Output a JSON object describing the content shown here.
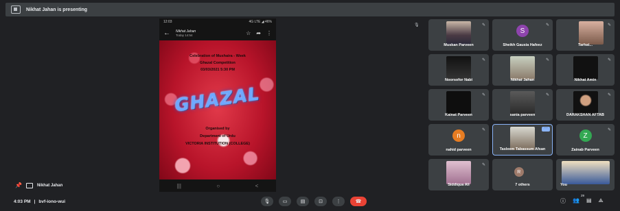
{
  "banner": {
    "text": "Nikhat Jahan is presenting"
  },
  "phone": {
    "status_time": "12:03",
    "status_right": "4G LTE ◢ 46%",
    "sender": "Nikhat Jahan",
    "date": "Today 14:54",
    "back_icon": "arrow-left-icon",
    "star_icon": "star-icon",
    "share_icon": "share-icon",
    "menu_icon": "more-vert-icon"
  },
  "poster": {
    "line1": "Celebration of Mushaira - Week",
    "line2": "Ghazal Competition",
    "line3": "03/03/2021   5:30 PM",
    "title": "GHAZAL",
    "line4": "Organised by",
    "line5": "Department of Urdu",
    "line6": "VICTORIA INSTITUTION (COLLEGE)"
  },
  "nav": {
    "recent": "|||",
    "home": "○",
    "back": "<"
  },
  "presenter": {
    "name": "Nikhat Jahan"
  },
  "tiles": [
    {
      "name": "Muskan Parveen"
    },
    {
      "name": "Sheikh Gausia Hafeez",
      "initial": "S"
    },
    {
      "name": "Tarhat..."
    },
    {
      "name": "Noorsofor Nabi"
    },
    {
      "name": "Nikhat Jahan"
    },
    {
      "name": "Nikhat Amin"
    },
    {
      "name": "Kainat Parveen"
    },
    {
      "name": "sania parveen"
    },
    {
      "name": "DARAKSHAN AFTAB"
    },
    {
      "name": "nahid parveen",
      "initial": "n"
    },
    {
      "name": "Tasleem Tabassum Afsan"
    },
    {
      "name": "Zainab Parveen",
      "initial": "Z"
    },
    {
      "name": "Siddiqua Ali"
    },
    {
      "name": "7 others"
    },
    {
      "name": "You"
    }
  ],
  "bottom": {
    "time": "4:03 PM",
    "separator": "|",
    "code": "bvf-iono-wui",
    "participants_count": "29"
  },
  "colors": {
    "background": "#202124",
    "tile": "#3c4043",
    "end_call": "#ea4335",
    "active_border": "#8ab4f8"
  }
}
